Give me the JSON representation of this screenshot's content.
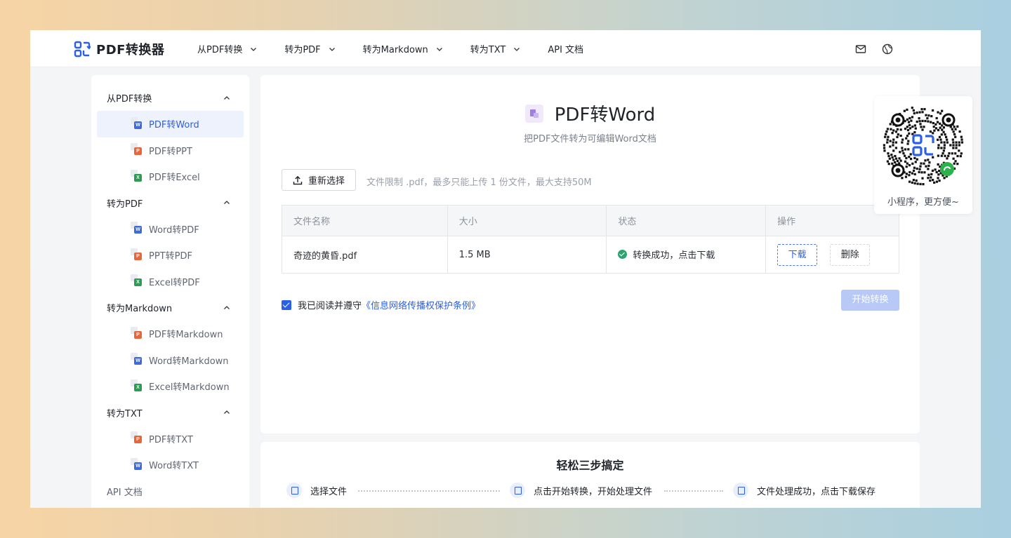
{
  "brand": {
    "name": "PDF转换器",
    "accent": "#2c5fe3"
  },
  "nav": [
    {
      "label": "从PDF转换",
      "dropdown": true
    },
    {
      "label": "转为PDF",
      "dropdown": true
    },
    {
      "label": "转为Markdown",
      "dropdown": true
    },
    {
      "label": "转为TXT",
      "dropdown": true
    },
    {
      "label": "API 文档",
      "dropdown": false
    }
  ],
  "header_icons": [
    "mail-icon",
    "globe-icon"
  ],
  "sidebar": {
    "groups": [
      {
        "label": "从PDF转换",
        "items": [
          {
            "label": "PDF转Word",
            "icon": "W",
            "color": "#3f6bd8",
            "active": true
          },
          {
            "label": "PDF转PPT",
            "icon": "P",
            "color": "#e5673b",
            "active": false
          },
          {
            "label": "PDF转Excel",
            "icon": "X",
            "color": "#2e9a56",
            "active": false
          }
        ]
      },
      {
        "label": "转为PDF",
        "items": [
          {
            "label": "Word转PDF",
            "icon": "W",
            "color": "#3f6bd8",
            "active": false
          },
          {
            "label": "PPT转PDF",
            "icon": "P",
            "color": "#e5673b",
            "active": false
          },
          {
            "label": "Excel转PDF",
            "icon": "X",
            "color": "#2e9a56",
            "active": false
          }
        ]
      },
      {
        "label": "转为Markdown",
        "items": [
          {
            "label": "PDF转Markdown",
            "icon": "P",
            "color": "#e5673b",
            "active": false
          },
          {
            "label": "Word转Markdown",
            "icon": "W",
            "color": "#3f6bd8",
            "active": false
          },
          {
            "label": "Excel转Markdown",
            "icon": "X",
            "color": "#2e9a56",
            "active": false
          }
        ]
      },
      {
        "label": "转为TXT",
        "items": [
          {
            "label": "PDF转TXT",
            "icon": "P",
            "color": "#e5673b",
            "active": false
          },
          {
            "label": "Word转TXT",
            "icon": "W",
            "color": "#3f6bd8",
            "active": false
          }
        ]
      }
    ],
    "api_label": "API 文档"
  },
  "main": {
    "title": "PDF转Word",
    "subtitle": "把PDF文件转为可编辑Word文档",
    "reselect_label": "重新选择",
    "limit_text": "文件限制 .pdf，最多只能上传 1 份文件，最大支持50M",
    "table": {
      "headers": [
        "文件名称",
        "大小",
        "状态",
        "操作"
      ],
      "rows": [
        {
          "name": "奇迹的黄昏.pdf",
          "size": "1.5 MB",
          "status": "转换成功，点击下载",
          "download": "下载",
          "delete": "删除"
        }
      ]
    },
    "agree_prefix": "我已阅读并遵守",
    "agree_link": "《信息网络传播权保护条例》",
    "agree_checked": true,
    "start_label": "开始转换"
  },
  "steps": {
    "title": "轻松三步搞定",
    "items": [
      "选择文件",
      "点击开始转换，开始处理文件",
      "文件处理成功，点击下载保存"
    ]
  },
  "qr": {
    "caption": "小程序，更方便~"
  }
}
